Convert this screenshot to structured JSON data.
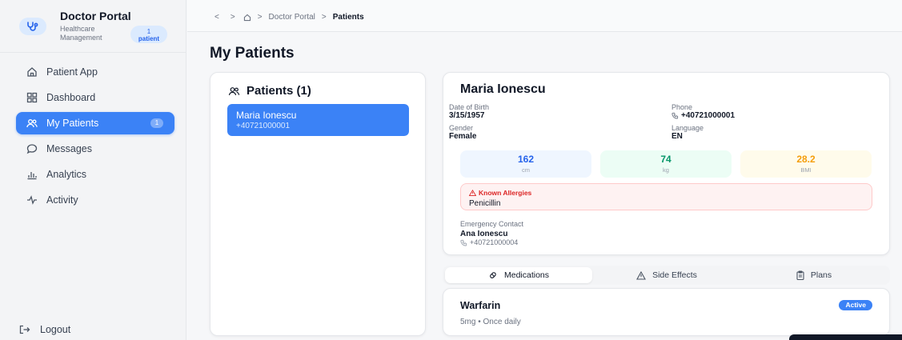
{
  "brand": {
    "title": "Doctor Portal",
    "subtitle": "Healthcare Management",
    "badge_count": "1",
    "badge_label": "patient"
  },
  "nav": {
    "items": [
      {
        "label": "Patient App",
        "icon": "home-icon"
      },
      {
        "label": "Dashboard",
        "icon": "grid-icon"
      },
      {
        "label": "My Patients",
        "icon": "users-icon",
        "count": "1",
        "active": true
      },
      {
        "label": "Messages",
        "icon": "chat-bubble-icon"
      },
      {
        "label": "Analytics",
        "icon": "bar-chart-icon"
      },
      {
        "label": "Activity",
        "icon": "activity-pulse-icon"
      }
    ],
    "logout_label": "Logout"
  },
  "breadcrumb": {
    "back": "<",
    "forward": ">",
    "separator": ">",
    "section": "Doctor Portal",
    "current": "Patients"
  },
  "page": {
    "title": "My Patients"
  },
  "patients_panel": {
    "title": "Patients (1)",
    "patients": [
      {
        "name": "Maria Ionescu",
        "phone": "+40721000001"
      }
    ]
  },
  "patient_detail": {
    "name": "Maria Ionescu",
    "dob_label": "Date of Birth",
    "dob": "3/15/1957",
    "phone_label": "Phone",
    "phone": "+40721000001",
    "gender_label": "Gender",
    "gender": "Female",
    "language_label": "Language",
    "language": "EN",
    "height": {
      "value": "162",
      "unit": "cm",
      "color": "#2563eb"
    },
    "weight": {
      "value": "74",
      "unit": "kg",
      "color": "#059669"
    },
    "bmi": {
      "value": "28.2",
      "unit": "BMI",
      "color": "#f59e0b"
    },
    "allergies_label": "Known Allergies",
    "allergies": "Penicillin",
    "emergency_label": "Emergency Contact",
    "emergency_name": "Ana Ionescu",
    "emergency_phone": "+40721000004"
  },
  "tabs": [
    {
      "label": "Medications",
      "icon": "pill-icon",
      "active": true
    },
    {
      "label": "Side Effects",
      "icon": "warning-triangle-icon"
    },
    {
      "label": "Plans",
      "icon": "clipboard-icon"
    }
  ],
  "medications": [
    {
      "name": "Warfarin",
      "dose": "5mg • Once daily",
      "status": "Active"
    }
  ],
  "colors": {
    "accent": "#3b82f6",
    "danger": "#dc2626"
  }
}
